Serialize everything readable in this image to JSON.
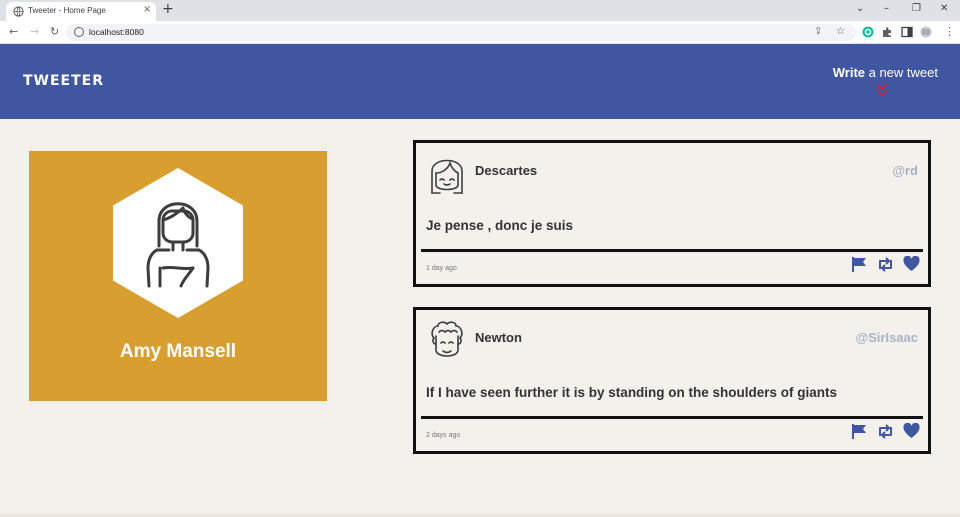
{
  "browser": {
    "tab_title": "Tweeter - Home Page",
    "tab_close": "×",
    "new_tab": "+",
    "url": "localhost:8080"
  },
  "nav": {
    "brand": "TWEETER",
    "write_bold": "Write",
    "write_rest": " a new tweet"
  },
  "profile": {
    "name": "Amy Mansell"
  },
  "tweets": [
    {
      "name": "Descartes",
      "handle": "@rd",
      "body": "Je pense , donc je suis",
      "time": "1 day ago"
    },
    {
      "name": "Newton",
      "handle": "@SirIsaac",
      "body": "If I have seen further it is by standing on the shoulders of giants",
      "time": "2 days ago"
    }
  ],
  "colors": {
    "nav": "#4056a1",
    "profile_bg": "#d99e30",
    "page_bg": "#f4f1ec",
    "handle": "#a7b3c8",
    "accent_arrow": "#d61f3a"
  }
}
